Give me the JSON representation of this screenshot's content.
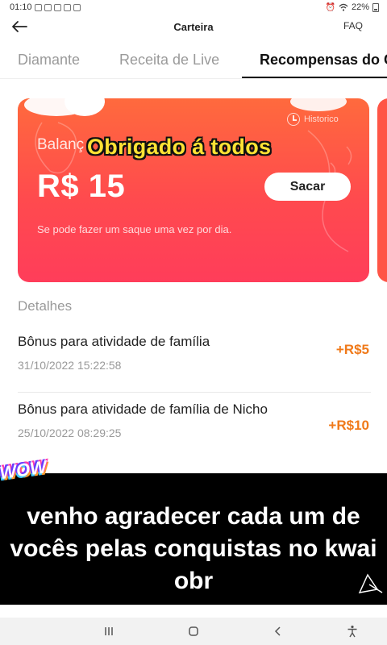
{
  "status_bar": {
    "time": "01:10",
    "battery": "22%"
  },
  "header": {
    "title": "Carteira",
    "faq_label": "FAQ"
  },
  "tabs": [
    {
      "label": "Diamante",
      "active": false
    },
    {
      "label": "Receita de Live",
      "active": false
    },
    {
      "label": "Recompensas do C",
      "active": true
    }
  ],
  "card": {
    "balance_label": "Balanç",
    "amount": "R$ 15",
    "withdraw_label": "Sacar",
    "note": "Se pode fazer um saque uma vez por dia.",
    "history_label": "Historico",
    "overlay_title": "Obrigado á todos",
    "colors": {
      "gradient_top": "#ff6a3d",
      "gradient_bottom": "#ff3d5a"
    }
  },
  "details": {
    "title": "Detalhes",
    "transactions": [
      {
        "title": "Bônus para atividade de família",
        "date": "31/10/2022 15:22:58",
        "amount": "+R$5"
      },
      {
        "title": "Bônus para atividade de família de Nicho",
        "date": "25/10/2022 08:29:25",
        "amount": "+R$10"
      }
    ],
    "amount_color": "#f07a1a"
  },
  "subtitle": {
    "sticker": "WOW",
    "text": "venho agradecer cada um de vocês pelas conquistas no kwai obr"
  },
  "navbar": {
    "icons": [
      "recents-icon",
      "home-icon",
      "back-icon",
      "accessibility-icon"
    ]
  }
}
